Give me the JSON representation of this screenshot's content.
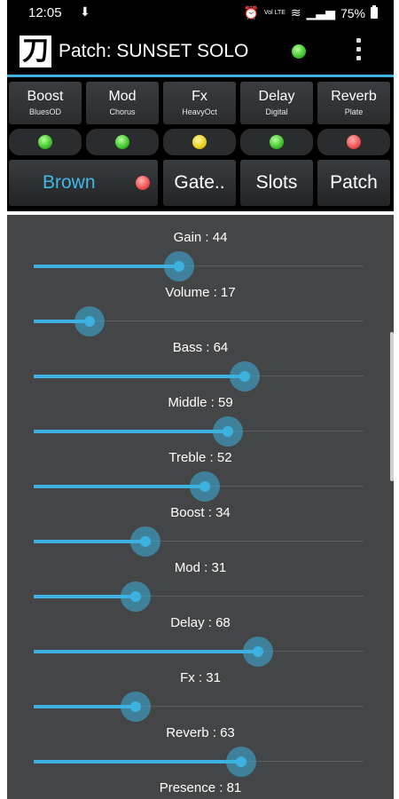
{
  "status_bar": {
    "time": "12:05",
    "download_icon": "download-icon",
    "network": "Vol LTE",
    "battery": "75%"
  },
  "app_bar": {
    "logo_glyph": "刀",
    "title": "Patch: SUNSET SOLO",
    "status_led_color": "#3ec42a",
    "menu_icon": "kebab-menu-icon"
  },
  "effects": [
    {
      "label": "Boost",
      "sub": "BluesOD",
      "led": "green"
    },
    {
      "label": "Mod",
      "sub": "Chorus",
      "led": "green"
    },
    {
      "label": "Fx",
      "sub": "HeavyOct",
      "led": "yellow"
    },
    {
      "label": "Delay",
      "sub": "Digital",
      "led": "green"
    },
    {
      "label": "Reverb",
      "sub": "Plate",
      "led": "red"
    }
  ],
  "bottom_buttons": {
    "amp": "Brown",
    "amp_led": "red",
    "gate": "Gate..",
    "slots": "Slots",
    "patch": "Patch"
  },
  "sliders": [
    {
      "label": "Gain : 44",
      "value": 44
    },
    {
      "label": "Volume : 17",
      "value": 17
    },
    {
      "label": "Bass : 64",
      "value": 64
    },
    {
      "label": "Middle : 59",
      "value": 59
    },
    {
      "label": "Treble : 52",
      "value": 52
    },
    {
      "label": "Boost : 34",
      "value": 34
    },
    {
      "label": "Mod : 31",
      "value": 31
    },
    {
      "label": "Delay : 68",
      "value": 68
    },
    {
      "label": "Fx : 31",
      "value": 31
    },
    {
      "label": "Reverb : 63",
      "value": 63
    },
    {
      "label": "Presence : 81",
      "value": 81
    }
  ],
  "accent_color": "#3db2e0"
}
